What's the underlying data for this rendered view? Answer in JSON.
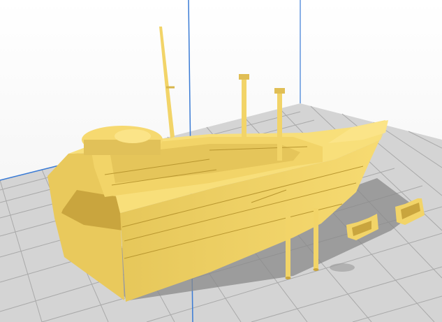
{
  "viewport": {
    "view": "3d-print-preview",
    "background_color": "#ffffff",
    "sky_gradient": [
      "#ffffff",
      "#eeeeee"
    ],
    "build_plate_color": "#d6d6d6",
    "grid_line_color": "#ababab",
    "axis_line_color": "#3a7bd5",
    "model_color": "#f5d76e",
    "model_shade_color": "#c9a93e",
    "model_dark_color": "#8f7426",
    "shadow_color": "#7a7a7a"
  },
  "objects": [
    {
      "name": "ship-hull-model"
    },
    {
      "name": "mast-pole-left"
    },
    {
      "name": "mast-pole-right"
    },
    {
      "name": "davit-bracket-left"
    },
    {
      "name": "davit-bracket-right"
    }
  ]
}
